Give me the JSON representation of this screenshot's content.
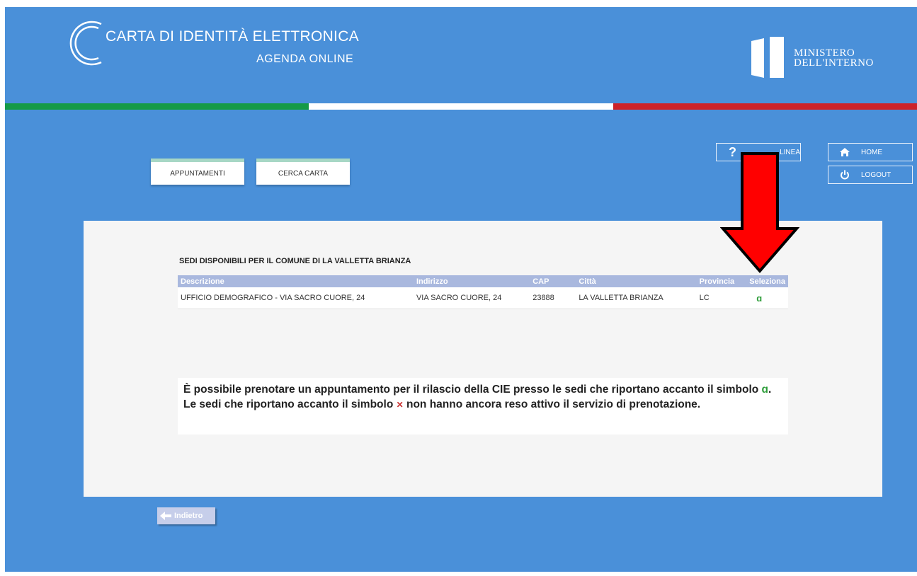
{
  "header": {
    "title_line1": "CARTA DI IDENTITÀ ELETTRONICA",
    "title_line2": "AGENDA ONLINE",
    "ministry_line1": "MINISTERO",
    "ministry_line2": "DELL'INTERNO"
  },
  "flag_colors": [
    "#159a47",
    "#ffffff",
    "#cc2229"
  ],
  "nav": {
    "appuntamenti": "APPUNTAMENTI",
    "cerca_carta": "CERCA CARTA"
  },
  "side": {
    "help_label": "LINEA",
    "help_icon": "question-icon",
    "home_label": "HOME",
    "home_icon": "house-icon",
    "logout_label": "LOGOUT",
    "logout_icon": "power-icon"
  },
  "section": {
    "title": "SEDI DISPONIBILI PER IL COMUNE DI LA VALLETTA BRIANZA"
  },
  "table": {
    "headers": [
      "Descrizione",
      "Indirizzo",
      "CAP",
      "Città",
      "Provincia",
      "Seleziona"
    ],
    "rows": [
      {
        "descrizione": "UFFICIO DEMOGRAFICO - VIA SACRO CUORE, 24",
        "indirizzo": "VIA SACRO CUORE, 24",
        "cap": "23888",
        "citta": "LA VALLETTA BRIANZA",
        "provincia": "LC",
        "seleziona": "⌁",
        "seleziona_icon": "select-check-icon"
      }
    ]
  },
  "info": {
    "part1": "È possibile prenotare un appuntamento per il rilascio della CIE presso le sedi che riportano accanto il simbolo",
    "symbol_ok": "ɑ",
    "part2": ". Le sedi che riportano accanto il simbolo",
    "symbol_ko": "✕",
    "part3": "non hanno ancora reso attivo il servizio di prenotazione."
  },
  "back": {
    "label": "Indietro",
    "icon": "arrow-left-icon"
  },
  "annotation": {
    "arrow_color": "#ff0000",
    "arrow_icon": "red-down-arrow-icon"
  }
}
